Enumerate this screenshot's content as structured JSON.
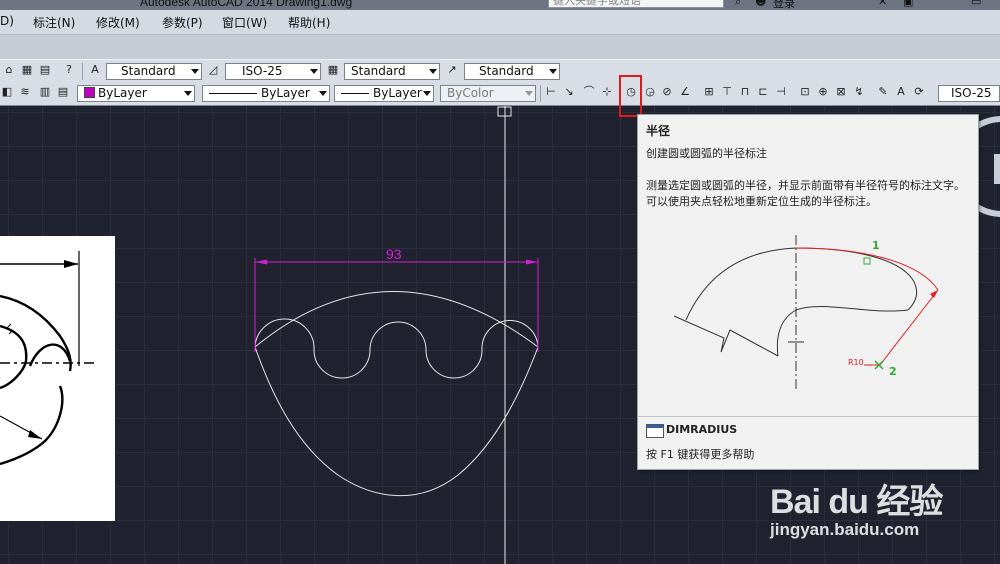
{
  "titlebar": {
    "title": "Autodesk AutoCAD 2014    Drawing1.dwg",
    "search_placeholder": "键入关键字或短语",
    "login_label": "登录"
  },
  "menu": [
    "D)",
    "标注(N)",
    "修改(M)",
    "参数(P)",
    "窗口(W)",
    "帮助(H)"
  ],
  "toolbar1": {
    "text_style": "Standard",
    "dim_style": "ISO-25",
    "table_style": "Standard",
    "multileader_style": "Standard"
  },
  "toolbar2": {
    "layer_color": "ByLayer",
    "linetype": "ByLayer",
    "lineweight": "ByLayer",
    "plot_style": "ByColor",
    "dim_style_right": "ISO-25",
    "layer_swatch_color": "#c000c0"
  },
  "drawing": {
    "dimension_text": "93",
    "dimension_color": "#d020d0"
  },
  "tooltip": {
    "title": "半径",
    "subtitle": "创建圆或圆弧的半径标注",
    "description": "测量选定圆或圆弧的半径，并显示前面带有半径符号的标注文字。可以使用夹点轻松地重新定位生成的半径标注。",
    "figure_label_1": "1",
    "figure_label_2": "2",
    "figure_dim": "R10",
    "command": "DIMRADIUS",
    "help": "按 F1 键获得更多帮助"
  },
  "watermark": {
    "brand": "Bai du 经验",
    "url": "jingyan.baidu.com"
  }
}
